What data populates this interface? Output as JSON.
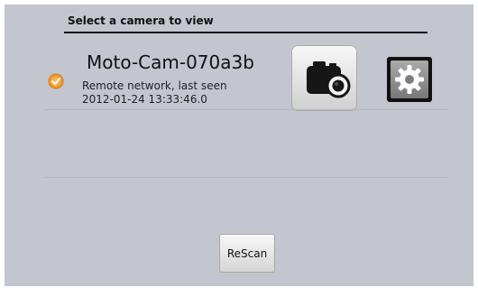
{
  "header": {
    "title": "Select a camera to view"
  },
  "camera_list": [
    {
      "name": "Moto-Cam-070a3b",
      "status_line1": "Remote network, last seen",
      "status_line2": "2012-01-24 13:33:46.0",
      "status_icon": "orange-check-icon"
    }
  ],
  "buttons": {
    "rescan_label": "ReScan",
    "camera_icon": "camera-icon",
    "settings_icon": "gear-icon"
  },
  "colors": {
    "background": "#c3c6ce",
    "status_orange": "#f39a2a"
  }
}
